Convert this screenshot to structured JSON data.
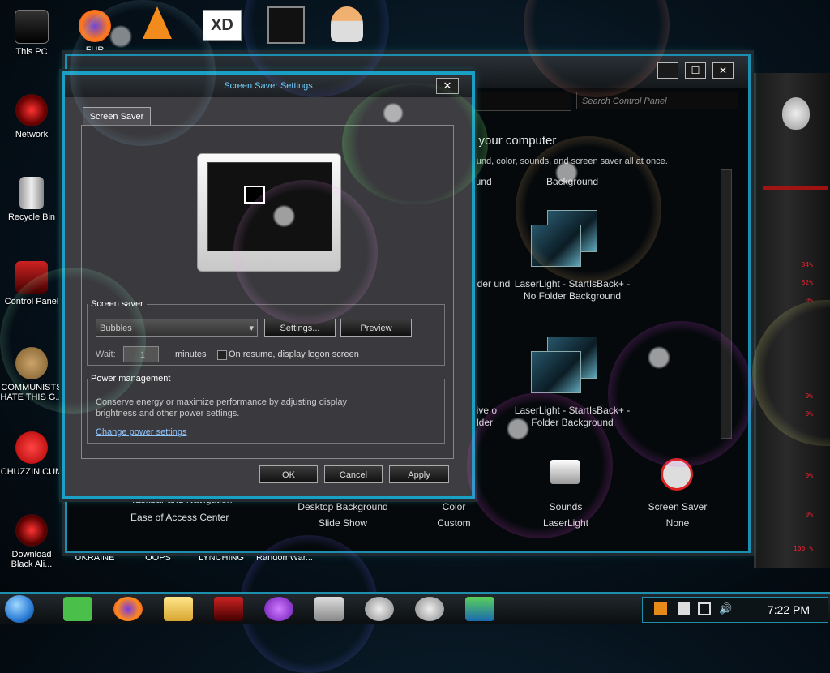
{
  "desktop_icons": [
    {
      "label": "This PC",
      "icon": "computer-icon"
    },
    {
      "label": "FUR",
      "icon": "firefox-icon"
    },
    {
      "label": "Network",
      "icon": "alien-network-icon"
    },
    {
      "label": "Recycle Bin",
      "icon": "recycle-bin-icon"
    },
    {
      "label": "Control Panel",
      "icon": "control-panel-icon"
    },
    {
      "label": "COMMUNISTS HATE THIS G...",
      "icon": "money-bag-icon"
    },
    {
      "label": "CHUZZIN CUM",
      "icon": "chuzzle-icon"
    },
    {
      "label": "Download Black Ali...",
      "icon": "alien-download-icon"
    },
    {
      "label": "UKRAINE",
      "icon": "shortcut-icon"
    },
    {
      "label": "OOPS",
      "icon": "shortcut-icon"
    },
    {
      "label": "LYNCHING",
      "icon": "shortcut-icon"
    },
    {
      "label": "RandomWar...",
      "icon": "shortcut-icon"
    }
  ],
  "top_icons": [
    "vlc-icon",
    "xd-icon",
    "game-icon",
    "doctor-icon"
  ],
  "control_panel": {
    "search_placeholder": "Search Control Panel",
    "heading": "n your computer",
    "subheading": "round, color, sounds, and screen saver all at once.",
    "themes": [
      {
        "label": "ground",
        "name": "partial-theme-1"
      },
      {
        "label": "Background",
        "name": "background-theme"
      },
      {
        "label": "D - Folder und",
        "name": "partial-theme-2"
      },
      {
        "label": "LaserLight - StartIsBack+ - No Folder Background",
        "name": "laserlight-no-folder"
      },
      {
        "label": "Native o Folder",
        "name": "partial-theme-3"
      },
      {
        "label": "LaserLight - StartIsBack+ - Folder Background",
        "name": "laserlight-folder"
      }
    ],
    "sidebar_links": [
      "Taskbar and Navigation",
      "Ease of Access Center"
    ],
    "bottom": [
      {
        "title": "Desktop Background",
        "value": "Slide Show"
      },
      {
        "title": "Color",
        "value": "Custom"
      },
      {
        "title": "Sounds",
        "value": "LaserLight"
      },
      {
        "title": "Screen Saver",
        "value": "None"
      }
    ]
  },
  "screen_saver": {
    "title": "Screen Saver Settings",
    "tab": "Screen Saver",
    "group_label": "Screen saver",
    "selected": "Bubbles",
    "settings_label": "Settings...",
    "preview_label": "Preview",
    "wait_label": "Wait:",
    "wait_value": "1",
    "minutes_label": "minutes",
    "resume_label": "On resume, display logon screen",
    "power_label": "Power management",
    "power_text": "Conserve energy or maximize performance by adjusting display brightness and other power settings.",
    "power_link": "Change power settings",
    "ok": "OK",
    "cancel": "Cancel",
    "apply": "Apply"
  },
  "alien_panel": {
    "percents": [
      "84%",
      "62%",
      "0%",
      "0%",
      "0%",
      "0%",
      "0%",
      "100 %"
    ]
  },
  "taskbar": {
    "apps": [
      "messages-icon",
      "firefox-icon",
      "file-explorer-icon",
      "alienware-icon",
      "game-icon",
      "monitor-icon",
      "alien-head-icon",
      "alien-head-icon",
      "display-settings-icon"
    ],
    "clock": "7:22 PM"
  }
}
